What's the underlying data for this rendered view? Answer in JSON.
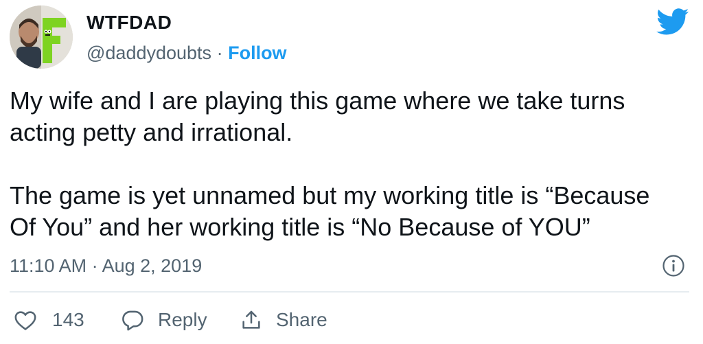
{
  "author": {
    "display_name": "WTFDAD",
    "handle": "@daddydoubts",
    "separator": "·",
    "follow_label": "Follow"
  },
  "tweet": {
    "text": "My wife and I are playing this game where we take turns\nacting petty and irrational.\n\nThe game is yet unnamed but my working title is “Because\nOf You” and her working title is “No Because of YOU”",
    "timestamp": "11:10 AM · Aug 2, 2019"
  },
  "actions": {
    "like_count": "143",
    "reply_label": "Reply",
    "share_label": "Share"
  },
  "icons": {
    "brand": "twitter-bird-icon",
    "info": "info-icon",
    "like": "heart-icon",
    "reply": "speech-bubble-icon",
    "share": "share-upload-icon"
  },
  "colors": {
    "accent": "#1d9bf0",
    "text": "#0f1419",
    "secondary_text": "#536471",
    "divider": "#e6ecf0",
    "background": "#ffffff"
  }
}
